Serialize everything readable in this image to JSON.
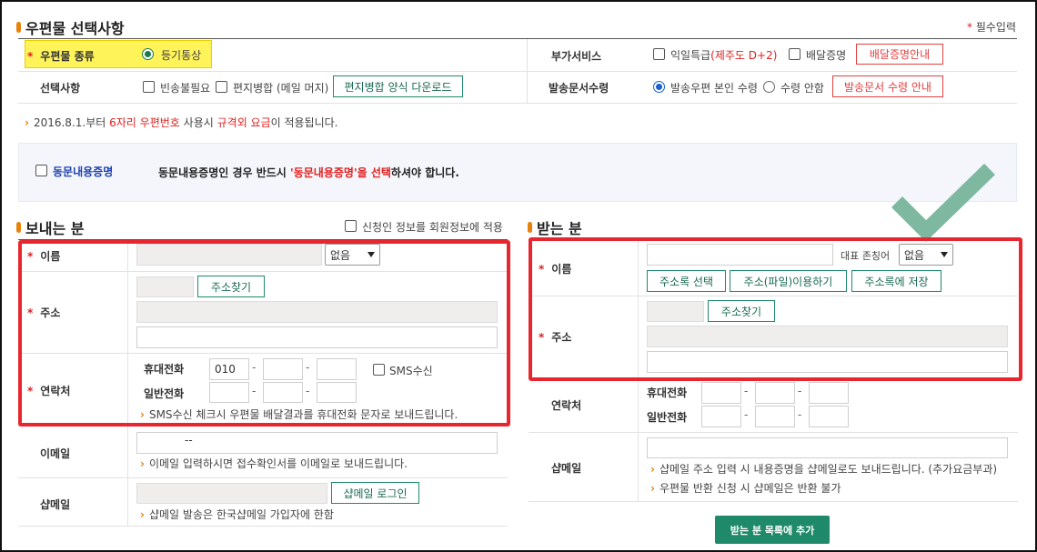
{
  "header": {
    "title": "우편물 선택사항",
    "required_marker": "*",
    "required_note": "필수입력"
  },
  "options": {
    "mail_type": {
      "label": "우편물 종류",
      "value": "등기통상"
    },
    "extra_service": {
      "label": "부가서비스",
      "next_day": "익일특급",
      "next_day_note": "(제주도 D+2)",
      "delivery_proof": "배달증명",
      "delivery_proof_btn": "배달증명안내"
    },
    "selection": {
      "label": "선택사항",
      "no_envelope": "빈송불필요",
      "merge_letter": "편지병합 (메일 머지)",
      "merge_download_btn": "편지병합 양식 다운로드"
    },
    "doc_receipt": {
      "label": "발송문서수령",
      "receive": "발송우편 본인 수령",
      "not_receive": "수령 안함",
      "guide_btn": "발송문서 수령 안내"
    }
  },
  "notice": {
    "arrow": "›",
    "prefix": "2016.8.1.부터",
    "highlight1": "6자리 우편번호",
    "middle": "사용시",
    "highlight2": "규격외 요금",
    "suffix": "이 적용됩니다."
  },
  "bulk_proof": {
    "label": "동문내용증명",
    "msg_prefix": "동문내용증명인 경우 반드시",
    "msg_highlight": "'동문내용증명'을 선택",
    "msg_suffix": "하셔야 합니다."
  },
  "sender": {
    "title": "보내는 분",
    "apply_member_info": "신청인 정보를 회원정보에 적용",
    "name_label": "이름",
    "name_select": "없음",
    "address_label": "주소",
    "address_btn": "주소찾기",
    "contact_label": "연락처",
    "mobile_label": "휴대전화",
    "mobile_prefix": "010",
    "sms_label": "SMS수신",
    "phone_label": "일반전화",
    "sms_note": "SMS수신 체크시 우편물 배달결과를 휴대전화 문자로 보내드립니다.",
    "email_label": "이메일",
    "email_value": "--",
    "email_note": "이메일 입력하시면 접수확인서를 이메일로 보내드립니다.",
    "shopmail_label": "샵메일",
    "shopmail_btn": "샵메일 로그인",
    "shopmail_note": "샵메일 발송은 한국샵메일 가입자에 한함"
  },
  "receiver": {
    "title": "받는 분",
    "name_label": "이름",
    "nickname_label": "대표 존칭어",
    "nickname_select": "없음",
    "addrbook_select_btn": "주소록 선택",
    "addrbook_file_btn": "주소(파일)이용하기",
    "addrbook_save_btn": "주소록에 저장",
    "address_label": "주소",
    "address_btn": "주소찾기",
    "contact_label": "연락처",
    "mobile_label": "휴대전화",
    "phone_label": "일반전화",
    "shopmail_label": "샵메일",
    "shopmail_note1": "샵메일 주소 입력 시 내용증명을 샵메일로도 보내드립니다. (추가요금부과)",
    "shopmail_note2": "우편물 반환 신청 시 샵메일은 반환 불가",
    "add_btn": "받는 분 목록에 추가"
  },
  "colors": {
    "accent_orange": "#e8820c",
    "required_red": "#e02020",
    "button_green": "#1f8a6a",
    "highlight_yellow": "#fff35a",
    "annotation_red": "#e8262f",
    "checkmark_green": "#7fb8a0"
  },
  "icons": {
    "bullet": "orange-bar-icon",
    "checkmark": "checkmark-icon"
  }
}
